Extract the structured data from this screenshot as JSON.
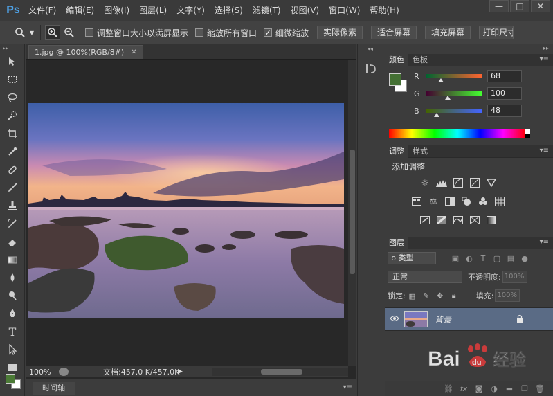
{
  "app": {
    "logo": "Ps"
  },
  "menu": [
    "文件(F)",
    "编辑(E)",
    "图像(I)",
    "图层(L)",
    "文字(Y)",
    "选择(S)",
    "滤镜(T)",
    "视图(V)",
    "窗口(W)",
    "帮助(H)"
  ],
  "window_controls": {
    "minimize": "—",
    "maximize": "□",
    "close": "✕"
  },
  "options": {
    "resize_windows": "调整窗口大小以满屏显示",
    "zoom_all": "缩放所有窗口",
    "scrubby_zoom": "细微缩放",
    "scrubby_checked": "✓",
    "actual_pixels": "实际像素",
    "fit_screen": "适合屏幕",
    "fill_screen": "填充屏幕",
    "print_size": "打印尺寸"
  },
  "document": {
    "tab_title": "1.jpg @ 100%(RGB/8#)",
    "tab_close": "✕",
    "zoom": "100%",
    "doc_info": "文档:457.0 K/457.0K",
    "timeline": "时间轴"
  },
  "color_panel": {
    "tabs": [
      "颜色",
      "色板"
    ],
    "channels": [
      {
        "label": "R",
        "value": "68",
        "fraction": 0.267
      },
      {
        "label": "G",
        "value": "100",
        "fraction": 0.392
      },
      {
        "label": "B",
        "value": "48",
        "fraction": 0.188
      }
    ],
    "foreground": "#446430",
    "background": "#ffffff"
  },
  "adjustments_panel": {
    "tabs": [
      "调整",
      "样式"
    ],
    "title": "添加调整"
  },
  "layers_panel": {
    "tab": "图层",
    "filter_kind": "ρ 类型",
    "blend_mode": "正常",
    "opacity_label": "不透明度:",
    "opacity_value": "100%",
    "lock_label": "锁定:",
    "fill_label": "填充:",
    "fill_value": "100%",
    "layer_name": "背景"
  },
  "watermark": {
    "brand": "Bai",
    "paw": "du",
    "suffix": "经验"
  },
  "colors": {
    "accent_ps": "#4fa3e8",
    "layer_selected": "#5a6b85",
    "panel_bg": "#3c3c3c"
  }
}
